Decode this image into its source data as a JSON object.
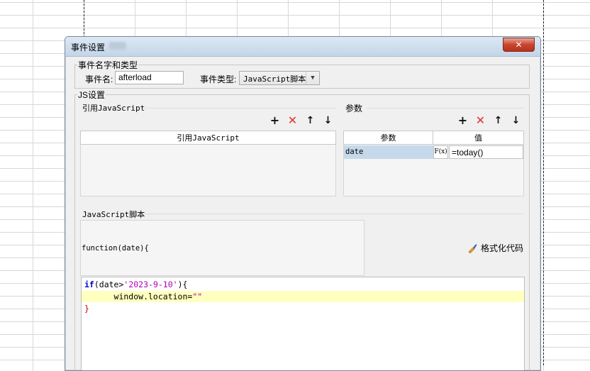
{
  "dialog": {
    "title": "事件设置",
    "close_glyph": "✕"
  },
  "event_group": {
    "legend": "事件名字和类型",
    "name_label": "事件名:",
    "name_value": "afterload",
    "type_label": "事件类型:",
    "type_value": "JavaScript脚本"
  },
  "js_group": {
    "legend": "JS设置",
    "ref_section": {
      "label": "引用JavaScript",
      "column_header": "引用JavaScript"
    },
    "params_section": {
      "label": "参数",
      "columns": [
        "参数",
        "值"
      ],
      "rows": [
        {
          "param": "date",
          "formula_icon": "F(x)",
          "value": "=today()"
        }
      ]
    },
    "toolbar_icons": [
      "add-icon",
      "delete-icon",
      "arrow-up-icon",
      "arrow-down-icon"
    ],
    "toolbar_glyphs": {
      "add": "+",
      "delete": "✕",
      "up": "↑",
      "down": "↓"
    },
    "script_section": {
      "label": "JavaScript脚本",
      "signature": "function(date){",
      "format_button": "格式化代码",
      "code_lines": {
        "line1_kw": "if",
        "line1_a": "(date>",
        "line1_str": "'2023-9-10'",
        "line1_b": "){",
        "line2_a": "      window.location=",
        "line2_str": "\"\"",
        "line3": "}"
      }
    }
  }
}
